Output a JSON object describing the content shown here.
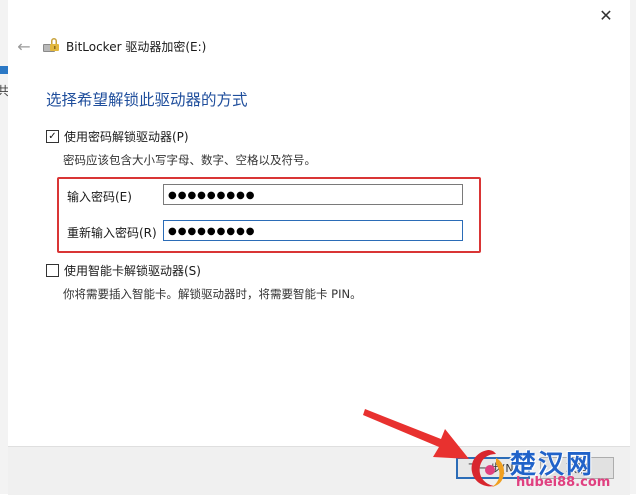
{
  "window": {
    "title": "BitLocker 驱动器加密(E:)",
    "close_glyph": "✕",
    "back_glyph": "←",
    "bg_char": "共"
  },
  "heading": "选择希望解锁此驱动器的方式",
  "password_option": {
    "label": "使用密码解锁驱动器(P)",
    "checked": true,
    "hint": "密码应该包含大小写字母、数字、空格以及符号。",
    "enter_label": "输入密码(E)",
    "enter_value": "●●●●●●●●●",
    "reenter_label": "重新输入密码(R)",
    "reenter_value": "●●●●●●●●●"
  },
  "smartcard_option": {
    "label": "使用智能卡解锁驱动器(S)",
    "checked": false,
    "hint": "你将需要插入智能卡。解锁驱动器时，将需要智能卡 PIN。"
  },
  "footer": {
    "next_label": "下一步(N)",
    "cancel_label": "取消"
  },
  "colors": {
    "heading": "#1f4e9c",
    "highlight": "#d93535",
    "arrow": "#e8312f",
    "focus": "#2b6cb7"
  },
  "watermark": {
    "brand": "楚汉网",
    "url": "hubei88.com"
  }
}
